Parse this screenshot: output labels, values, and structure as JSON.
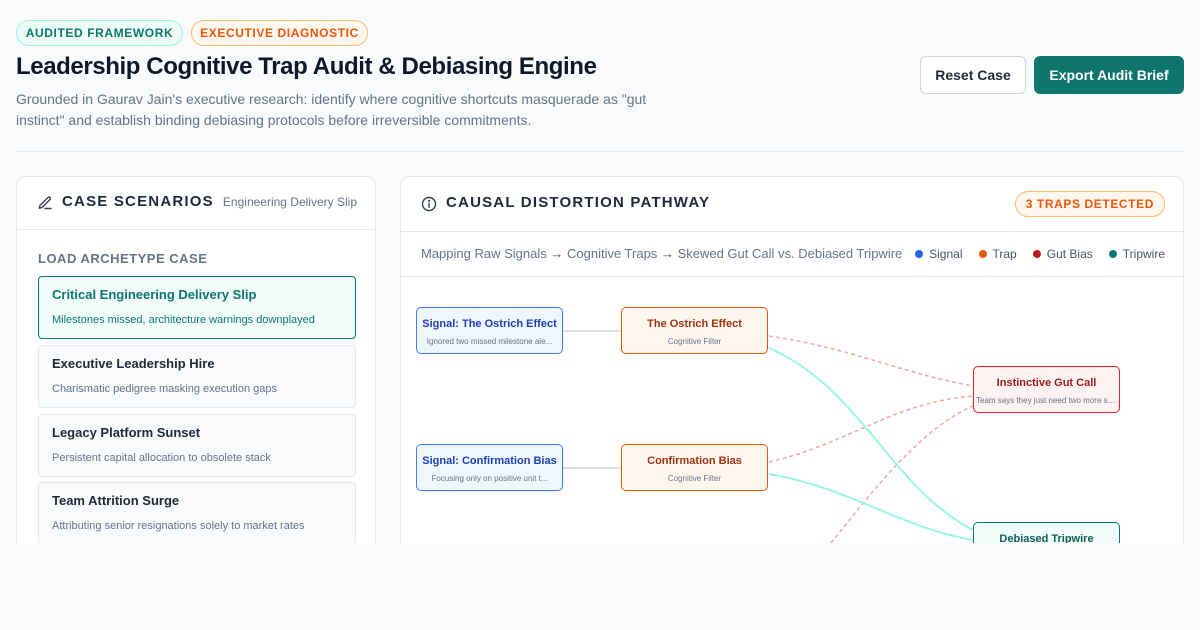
{
  "header": {
    "badges": [
      "AUDITED FRAMEWORK",
      "EXECUTIVE DIAGNOSTIC"
    ],
    "title": "Leadership Cognitive Trap Audit & Debiasing Engine",
    "subtitle": "Grounded in Gaurav Jain's executive research: identify where cognitive shortcuts masquerade as \"gut instinct\" and establish binding debiasing protocols before irreversible commitments.",
    "buttons": {
      "reset": "Reset Case",
      "export": "Export Audit Brief"
    }
  },
  "scenarios": {
    "title": "CASE SCENARIOS",
    "current": "Engineering Delivery Slip",
    "section_label": "LOAD ARCHETYPE CASE",
    "cases": [
      {
        "title": "Critical Engineering Delivery Slip",
        "desc": "Milestones missed, architecture warnings downplayed",
        "active": true
      },
      {
        "title": "Executive Leadership Hire",
        "desc": "Charismatic pedigree masking execution gaps",
        "active": false
      },
      {
        "title": "Legacy Platform Sunset",
        "desc": "Persistent capital allocation to obsolete stack",
        "active": false
      },
      {
        "title": "Team Attrition Surge",
        "desc": "Attributing senior resignations solely to market rates",
        "active": false
      }
    ]
  },
  "pathway": {
    "title": "CAUSAL DISTORTION PATHWAY",
    "traps_badge": "3 TRAPS DETECTED",
    "steps": [
      "Mapping Raw Signals",
      "Cognitive Traps",
      "Skewed Gut Call vs. Debiased Tripwire"
    ],
    "arrow": "→",
    "legend": [
      {
        "label": "Signal",
        "color": "#2563eb"
      },
      {
        "label": "Trap",
        "color": "#ea580c"
      },
      {
        "label": "Gut Bias",
        "color": "#b91c1c"
      },
      {
        "label": "Tripwire",
        "color": "#0f766e"
      }
    ],
    "nodes": {
      "signal1": {
        "title": "Signal: The Ostrich Effect",
        "sub": "Ignored two missed milestone ale..."
      },
      "trap1": {
        "title": "The Ostrich Effect",
        "sub": "Cognitive Filter"
      },
      "signal2": {
        "title": "Signal: Confirmation Bias",
        "sub": "Focusing only on positive unit t..."
      },
      "trap2": {
        "title": "Confirmation Bias",
        "sub": "Cognitive Filter"
      },
      "gut": {
        "title": "Instinctive Gut Call",
        "sub": "Team says they just need two more spri..."
      },
      "tripwire": {
        "title": "Debiased Tripwire",
        "sub": ""
      }
    }
  }
}
